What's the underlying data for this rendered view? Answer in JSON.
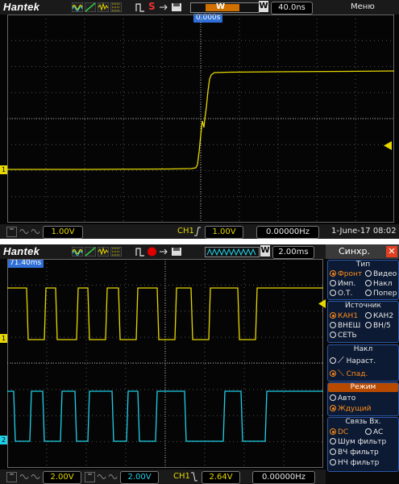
{
  "colors": {
    "ch1": "#e6d800",
    "ch2": "#1fd0e8",
    "trigger_marker": "#e6d800",
    "panel_accent": "#2c57a8",
    "selected": "#ff8c1a",
    "time_flag": "#2f6fd6"
  },
  "top": {
    "brand": "Hantek",
    "timebase": "40.0ns",
    "menu_label": "Меню",
    "trigger_time": "0.000s",
    "ch1_scale": "1.00V",
    "trig_channel": "CH1",
    "trig_level": "1.00V",
    "frequency": "0.00000Hz",
    "date": "1-June-17 08:02",
    "ch1_marker": "1",
    "window_icon": "W",
    "zoom_icon": "W"
  },
  "bottom": {
    "brand": "Hantek",
    "timebase": "2.00ms",
    "time_flag": "71.40ms",
    "ch1_scale": "2.00V",
    "ch2_scale": "2.00V",
    "trig_channel": "CH1",
    "trig_level": "2.64V",
    "frequency": "0.00000Hz",
    "ch1_marker": "1",
    "ch2_marker": "2",
    "zoom_icon": "W",
    "coupling_icon": "DC"
  },
  "sync_panel": {
    "title": "Синхр.",
    "type": {
      "label": "Тип",
      "options": [
        "Фронт",
        "Видео",
        "Имп.",
        "Накл",
        "О.Т.",
        "Попер"
      ],
      "selected": "Фронт"
    },
    "source": {
      "label": "Источник",
      "options": [
        "КАН1",
        "КАН2",
        "ВНЕШ",
        "ВН/5",
        "СЕТЬ"
      ],
      "selected": "КАН1"
    },
    "slope": {
      "label": "Накл",
      "options": [
        "Нараст.",
        "Спад."
      ],
      "selected": "Спад."
    },
    "mode": {
      "label": "Режим",
      "options": [
        "Авто",
        "Ждущий"
      ],
      "selected": "Ждущий"
    },
    "coupling": {
      "label": "Связь  Вх.",
      "options": [
        "DC",
        "AC",
        "Шум  фильтр",
        "ВЧ  фильтр",
        "НЧ  фильтр"
      ],
      "selected": "DC"
    }
  }
}
